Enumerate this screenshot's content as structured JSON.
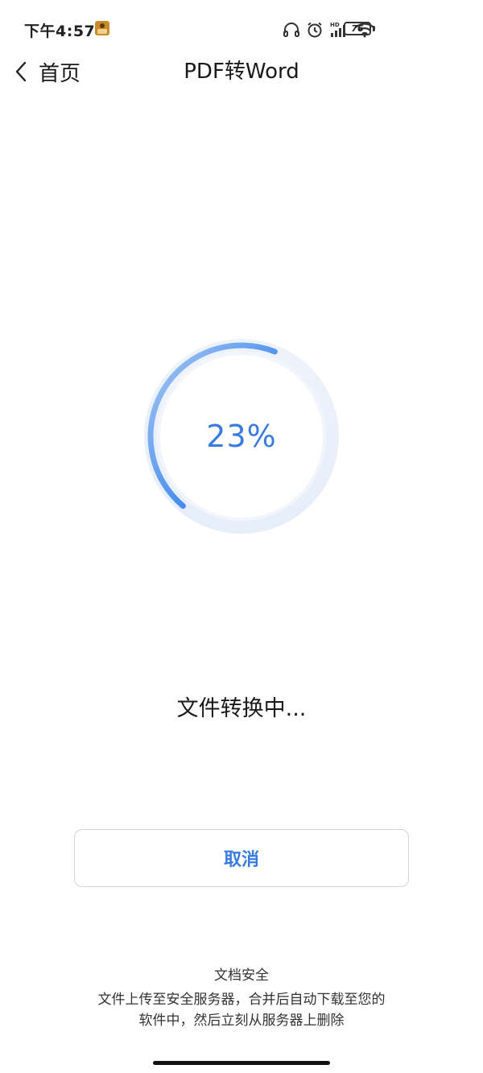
{
  "status_bar": {
    "time": "下午4:57",
    "battery": "76",
    "icons": [
      "headphones-icon",
      "alarm-icon",
      "hd-signal-icon",
      "wifi-icon",
      "battery-icon"
    ]
  },
  "nav": {
    "back_label": "首页",
    "title": "PDF转Word"
  },
  "progress": {
    "value": 0.23,
    "label": "23%"
  },
  "status_text": "文件转换中...",
  "cancel_label": "取消",
  "security": {
    "title": "文档安全",
    "line1": "文件上传至安全服务器，合并后自动下载至您的",
    "line2": "软件中，然后立刻从服务器上删除"
  },
  "colors": {
    "accent": "#3a7be0",
    "ring_track": "#e8eef9"
  }
}
